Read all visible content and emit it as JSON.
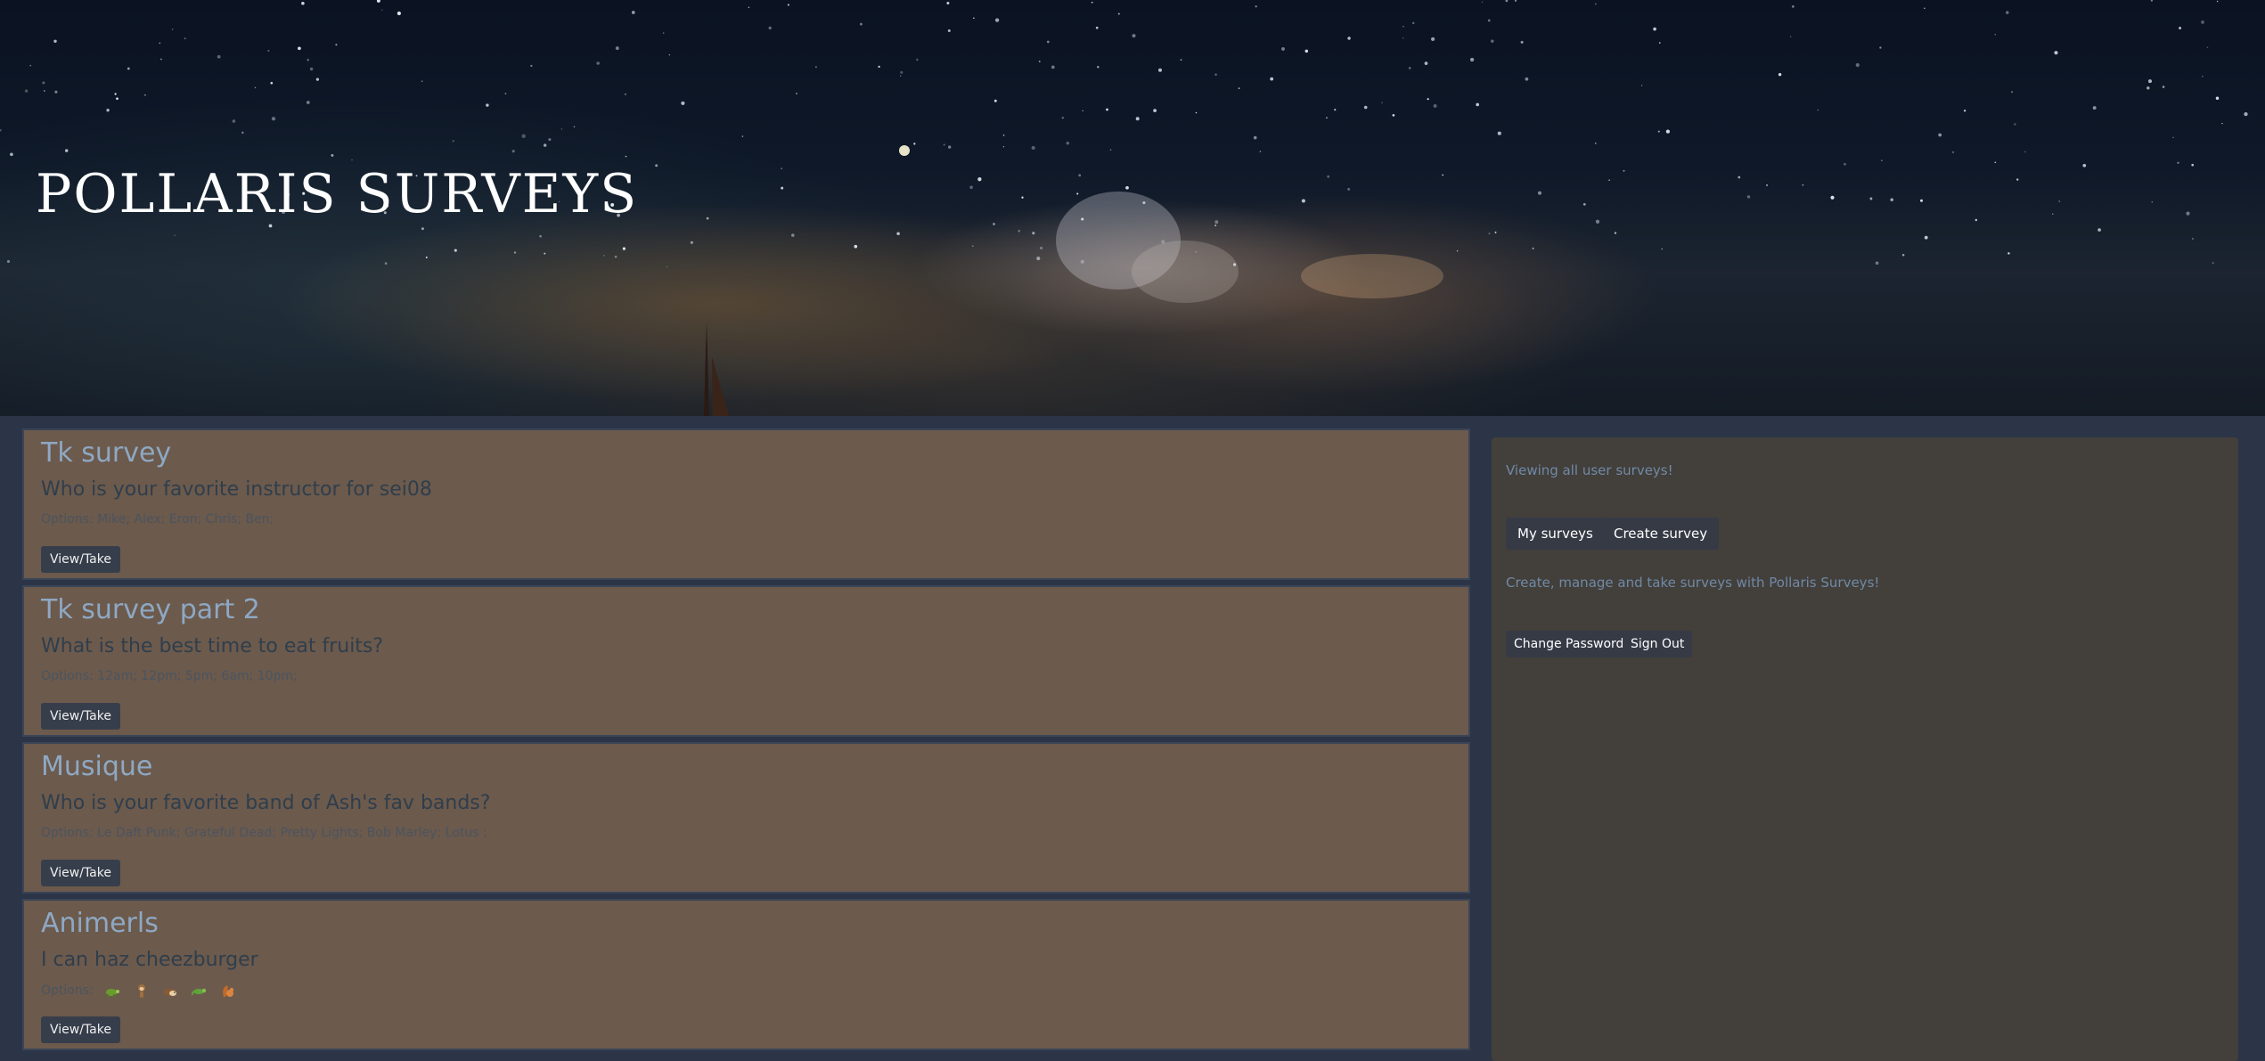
{
  "header": {
    "title": "POLLARIS SURVEYS"
  },
  "surveys": [
    {
      "title": "Tk survey",
      "question": "Who is your favorite instructor for sei08",
      "options_text": "Options: Mike; Alex; Eron; Chris; Ben;",
      "button_label": "View/Take"
    },
    {
      "title": "Tk survey part 2",
      "question": "What is the best time to eat fruits?",
      "options_text": "Options: 12am; 12pm; 5pm; 6am; 10pm;",
      "button_label": "View/Take"
    },
    {
      "title": "Musique",
      "question": "Who is your favorite band of Ash's fav bands?",
      "options_text": "Options: Le Daft Punk; Grateful Dead; Pretty Lights; Bob Marley; Lotus ;",
      "button_label": "View/Take"
    },
    {
      "title": "Animerls",
      "question": "I can haz cheezburger",
      "options_text": "Options:",
      "option_icons": [
        "turtle-icon",
        "monkey-icon",
        "hedgehog-icon",
        "lizard-icon",
        "squirrel-icon"
      ],
      "button_label": "View/Take"
    }
  ],
  "sidebar": {
    "status_text": "Viewing all user surveys!",
    "my_surveys_label": "My surveys",
    "create_survey_label": "Create survey",
    "tagline": "Create, manage and take surveys with Pollaris Surveys!",
    "change_password_label": "Change Password",
    "sign_out_label": "Sign Out"
  },
  "colors": {
    "card_background": "#6c5a4c",
    "title_blue": "#8ea8c4",
    "panel_background": "#433f3b",
    "button_dark": "#353a45"
  }
}
